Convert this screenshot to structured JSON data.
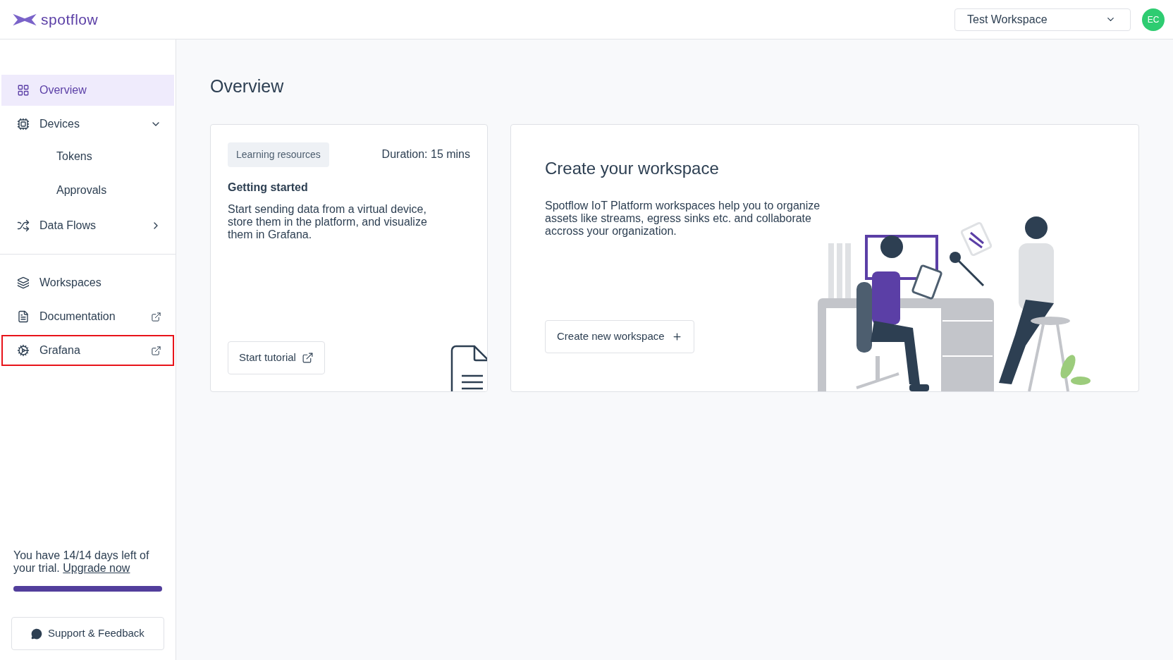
{
  "header": {
    "logo": "spotflow",
    "workspace_select": {
      "value": "Test Workspace"
    },
    "avatar": "EC"
  },
  "sidebar": {
    "sections": [
      {
        "items": [
          {
            "label": "Overview",
            "selected": true,
            "highlighted": false
          },
          {
            "label": "Devices",
            "selected": false,
            "highlighted": false,
            "expanded": true,
            "children": [
              {
                "label": "Tokens",
                "selected": false
              },
              {
                "label": "Approvals",
                "selected": false
              }
            ]
          },
          {
            "label": "Data Flows",
            "selected": false,
            "highlighted": false,
            "expanded": false
          }
        ]
      },
      {
        "items": [
          {
            "label": "Workspaces",
            "selected": false,
            "highlighted": false
          },
          {
            "label": "Documentation",
            "selected": false,
            "highlighted": false,
            "external": true
          },
          {
            "label": "Grafana",
            "selected": false,
            "highlighted": true,
            "external": true
          }
        ]
      }
    ],
    "trial": {
      "text": "You have 14/14 days left of your trial.",
      "link": "Upgrade now",
      "level": 1
    },
    "support_button": "Support & Feedback"
  },
  "page_title": "Overview",
  "tutorial_card": {
    "tag": "Learning resources",
    "duration": "Duration: 15 mins",
    "title": "Getting started",
    "description": "Start sending data from a virtual device, store them in the platform, and visualize them in Grafana.",
    "button": "Start tutorial"
  },
  "workspace_card": {
    "title": "Create your workspace",
    "description": "Spotflow IoT Platform workspaces help you to organize assets like streams, egress sinks etc. and collaborate accross your organization.",
    "button": "Create new workspace"
  }
}
